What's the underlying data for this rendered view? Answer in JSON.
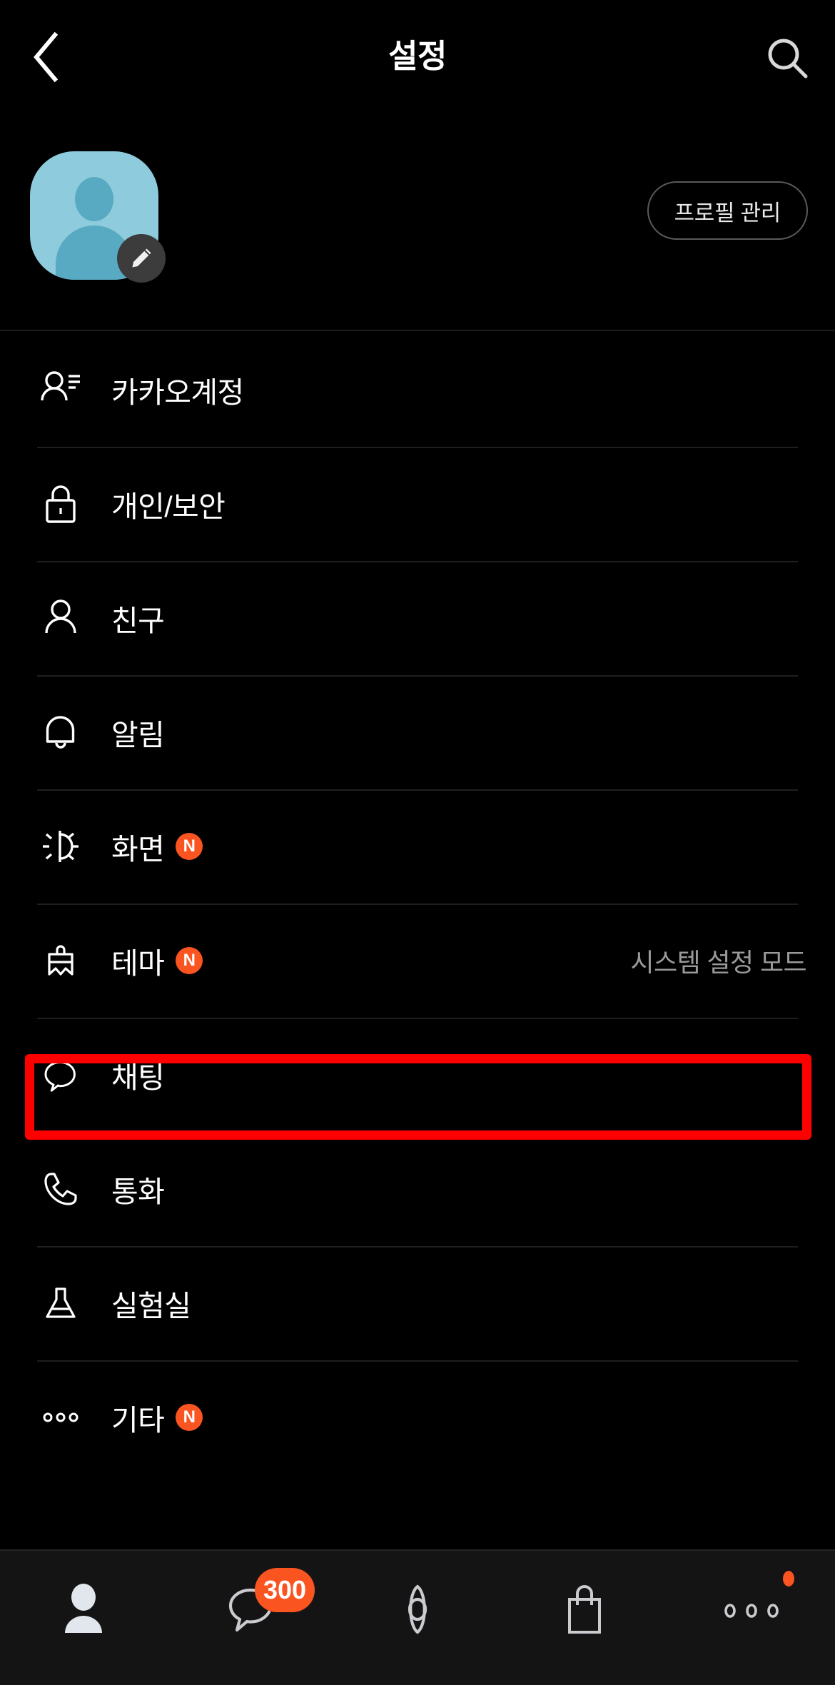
{
  "header": {
    "title": "설정",
    "back_icon": "chevron-left-icon",
    "search_icon": "search-icon"
  },
  "profile": {
    "avatar_icon": "default-person-avatar",
    "edit_icon": "pencil-icon",
    "manage_button_label": "프로필 관리"
  },
  "menu": {
    "items": [
      {
        "icon": "account-person-lines-icon",
        "label": "카카오계정",
        "badge": "",
        "value": ""
      },
      {
        "icon": "lock-icon",
        "label": "개인/보안",
        "badge": "",
        "value": ""
      },
      {
        "icon": "person-icon",
        "label": "친구",
        "badge": "",
        "value": ""
      },
      {
        "icon": "bell-icon",
        "label": "알림",
        "badge": "",
        "value": ""
      },
      {
        "icon": "brightness-sun-icon",
        "label": "화면",
        "badge": "N",
        "value": ""
      },
      {
        "icon": "paint-brush-icon",
        "label": "테마",
        "badge": "N",
        "value": "시스템 설정 모드"
      },
      {
        "icon": "chat-bubble-icon",
        "label": "채팅",
        "badge": "",
        "value": ""
      },
      {
        "icon": "phone-icon",
        "label": "통화",
        "badge": "",
        "value": ""
      },
      {
        "icon": "flask-icon",
        "label": "실험실",
        "badge": "",
        "value": ""
      },
      {
        "icon": "ellipsis-icon",
        "label": "기타",
        "badge": "N",
        "value": ""
      }
    ],
    "highlighted_index": 6
  },
  "bottom_nav": {
    "items": [
      {
        "icon": "friends-person-filled-icon",
        "badge": "",
        "dot": false
      },
      {
        "icon": "chat-bubble-icon",
        "badge": "300",
        "dot": false
      },
      {
        "icon": "openchat-eye-icon",
        "badge": "",
        "dot": false
      },
      {
        "icon": "shopping-bag-icon",
        "badge": "",
        "dot": false
      },
      {
        "icon": "more-ellipsis-icon",
        "badge": "",
        "dot": true
      }
    ]
  },
  "colors": {
    "background": "#000000",
    "accent_orange": "#fa5420",
    "highlight_red": "#fe0000",
    "avatar_blue": "#8dcbdd",
    "divider": "#1f1f1f",
    "muted_text": "#9a9a9a"
  }
}
